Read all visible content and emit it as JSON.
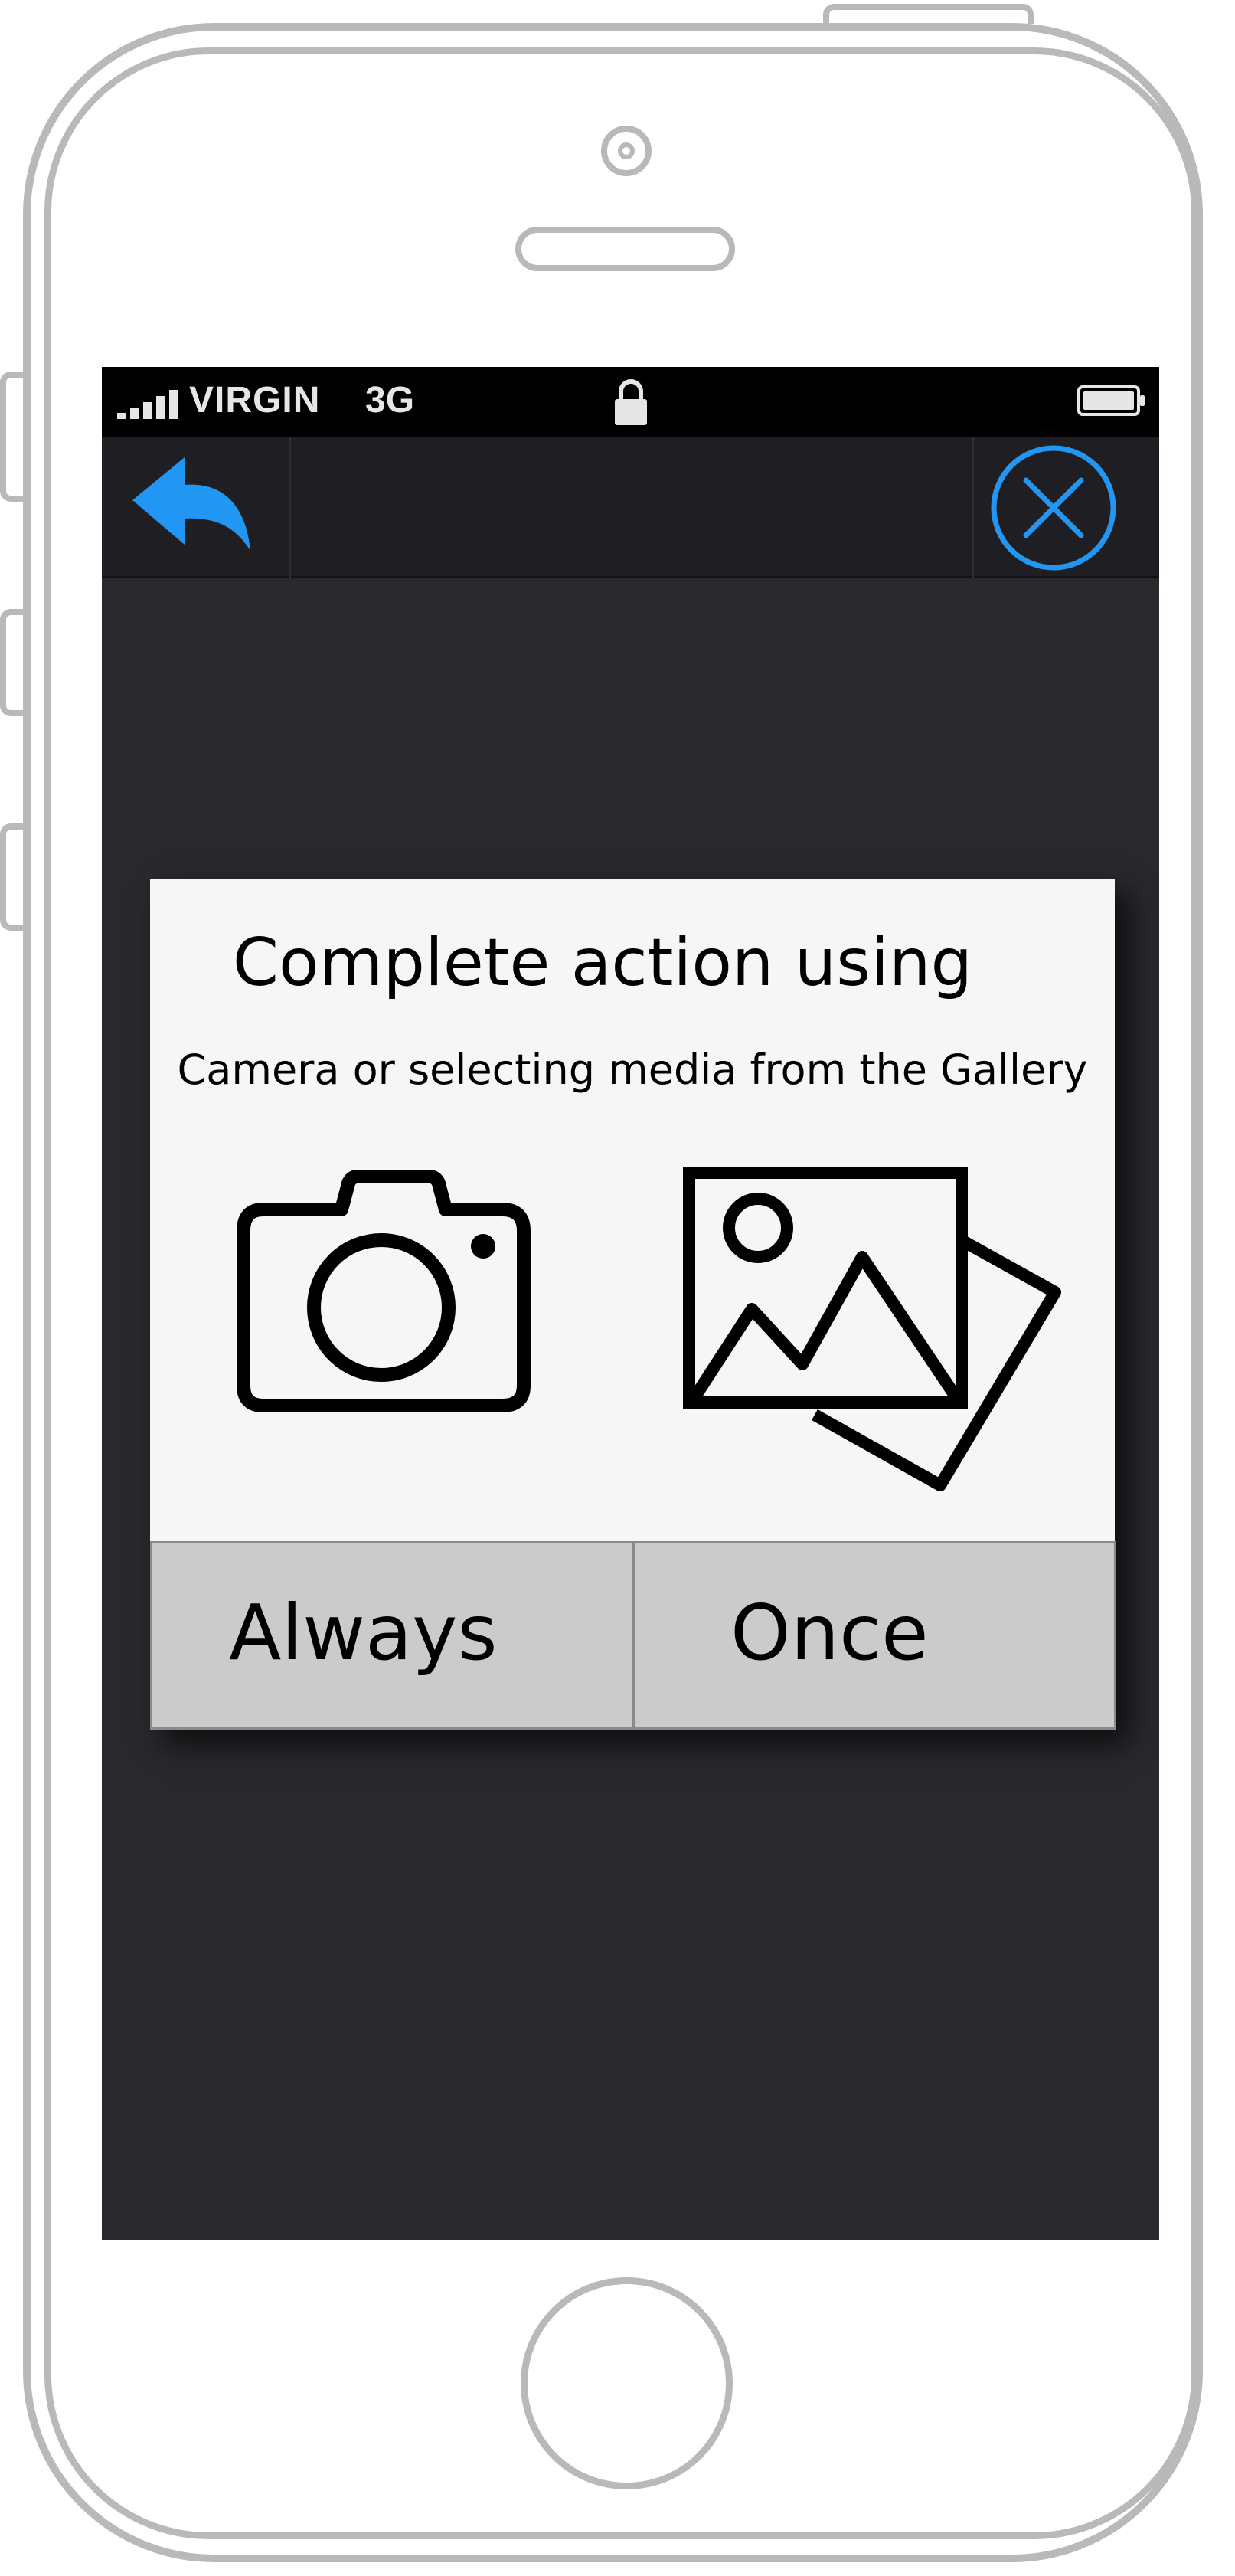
{
  "status_bar": {
    "carrier": "VIRGIN",
    "network": "3G",
    "signal_icon": "signal-bars-icon",
    "lock_icon": "padlock-icon",
    "battery_icon": "battery-icon"
  },
  "nav_bar": {
    "back_icon": "reply-arrow-icon",
    "close_icon": "close-circle-icon"
  },
  "dialog": {
    "title": "Complete action using",
    "subtitle": "Camera or selecting media from the Gallery",
    "options": [
      {
        "name": "camera",
        "icon": "camera-icon"
      },
      {
        "name": "gallery",
        "icon": "gallery-icon"
      }
    ],
    "buttons": {
      "always_label": "Always",
      "once_label": "Once"
    }
  },
  "colors": {
    "accent": "#2196f3",
    "screen_background": "#28282d",
    "status_bar": "#000000",
    "dialog_background": "#f6f6f6",
    "button_background": "#cbcbcb",
    "phone_frame": "#b9b9b9"
  }
}
